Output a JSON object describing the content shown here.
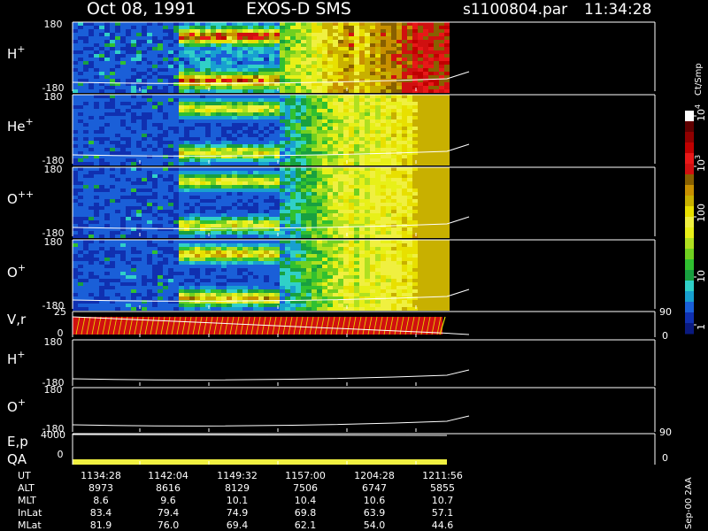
{
  "header": {
    "date": "Oct 08, 1991",
    "instrument": "EXOS-D SMS",
    "file": "s1100804.par",
    "time": "11:34:28"
  },
  "panels": [
    {
      "label_base": "H",
      "label_sup": "+",
      "top": "180",
      "bottom": "-180"
    },
    {
      "label_base": "He",
      "label_sup": "+",
      "top": "180",
      "bottom": "-180"
    },
    {
      "label_base": "O",
      "label_sup": "++",
      "top": "180",
      "bottom": "-180"
    },
    {
      "label_base": "O",
      "label_sup": "+",
      "top": "180",
      "bottom": "-180"
    }
  ],
  "vr_panel": {
    "label": "V,r",
    "top": "25",
    "bottom": "0",
    "right_top": "90",
    "right_bottom": "0"
  },
  "lower_panels": [
    {
      "label_base": "H",
      "label_sup": "+",
      "top": "180",
      "bottom": "-180"
    },
    {
      "label_base": "O",
      "label_sup": "+",
      "top": "180",
      "bottom": "-180"
    }
  ],
  "ep_panel": {
    "label1": "E,p",
    "label2": "QA",
    "top": "4000",
    "bottom": "0",
    "right_top": "90",
    "right_bottom": "0"
  },
  "colorbar": {
    "unit": "Ct/Smp",
    "ticks": [
      "1",
      "10",
      "100",
      "10",
      "10"
    ],
    "exps": [
      "",
      "",
      "",
      "3",
      "4"
    ],
    "colors": [
      "#0a1a80",
      "#1030b0",
      "#1a5fd8",
      "#18a0d0",
      "#30d0c8",
      "#18a040",
      "#30c030",
      "#70d020",
      "#b0e020",
      "#e8f018",
      "#f0f040",
      "#e8e000",
      "#c8b000",
      "#c89000",
      "#886000",
      "#d01010",
      "#e81818",
      "#c00000",
      "#900000",
      "#600000",
      "#ffffff"
    ]
  },
  "footer": {
    "created": "Sep-00 2AA"
  },
  "table": {
    "row_labels": [
      "UT",
      "ALT",
      "MLT",
      "InLat",
      "MLat"
    ],
    "columns": [
      [
        "1134:28",
        "8973",
        "8.6",
        "83.4",
        "81.9"
      ],
      [
        "1142:04",
        "8616",
        "9.6",
        "79.4",
        "76.0"
      ],
      [
        "1149:32",
        "8129",
        "10.1",
        "74.9",
        "69.4"
      ],
      [
        "1157:00",
        "7506",
        "10.4",
        "69.8",
        "62.1"
      ],
      [
        "1204:28",
        "6747",
        "10.6",
        "63.9",
        "54.0"
      ],
      [
        "1211:56",
        "5855",
        "10.7",
        "57.1",
        "44.6"
      ]
    ]
  },
  "chart_data": {
    "type": "heatmap",
    "title": "Oct 08, 1991   EXOS-D SMS",
    "x_ticks": [
      "1134:28",
      "1142:04",
      "1149:32",
      "1157:00",
      "1204:28",
      "1211:56"
    ],
    "species": [
      "H+",
      "He+",
      "O++",
      "O+"
    ],
    "y_range": [
      -180,
      180
    ],
    "colorbar_range": [
      1,
      10000
    ],
    "colorbar_scale": "log"
  }
}
